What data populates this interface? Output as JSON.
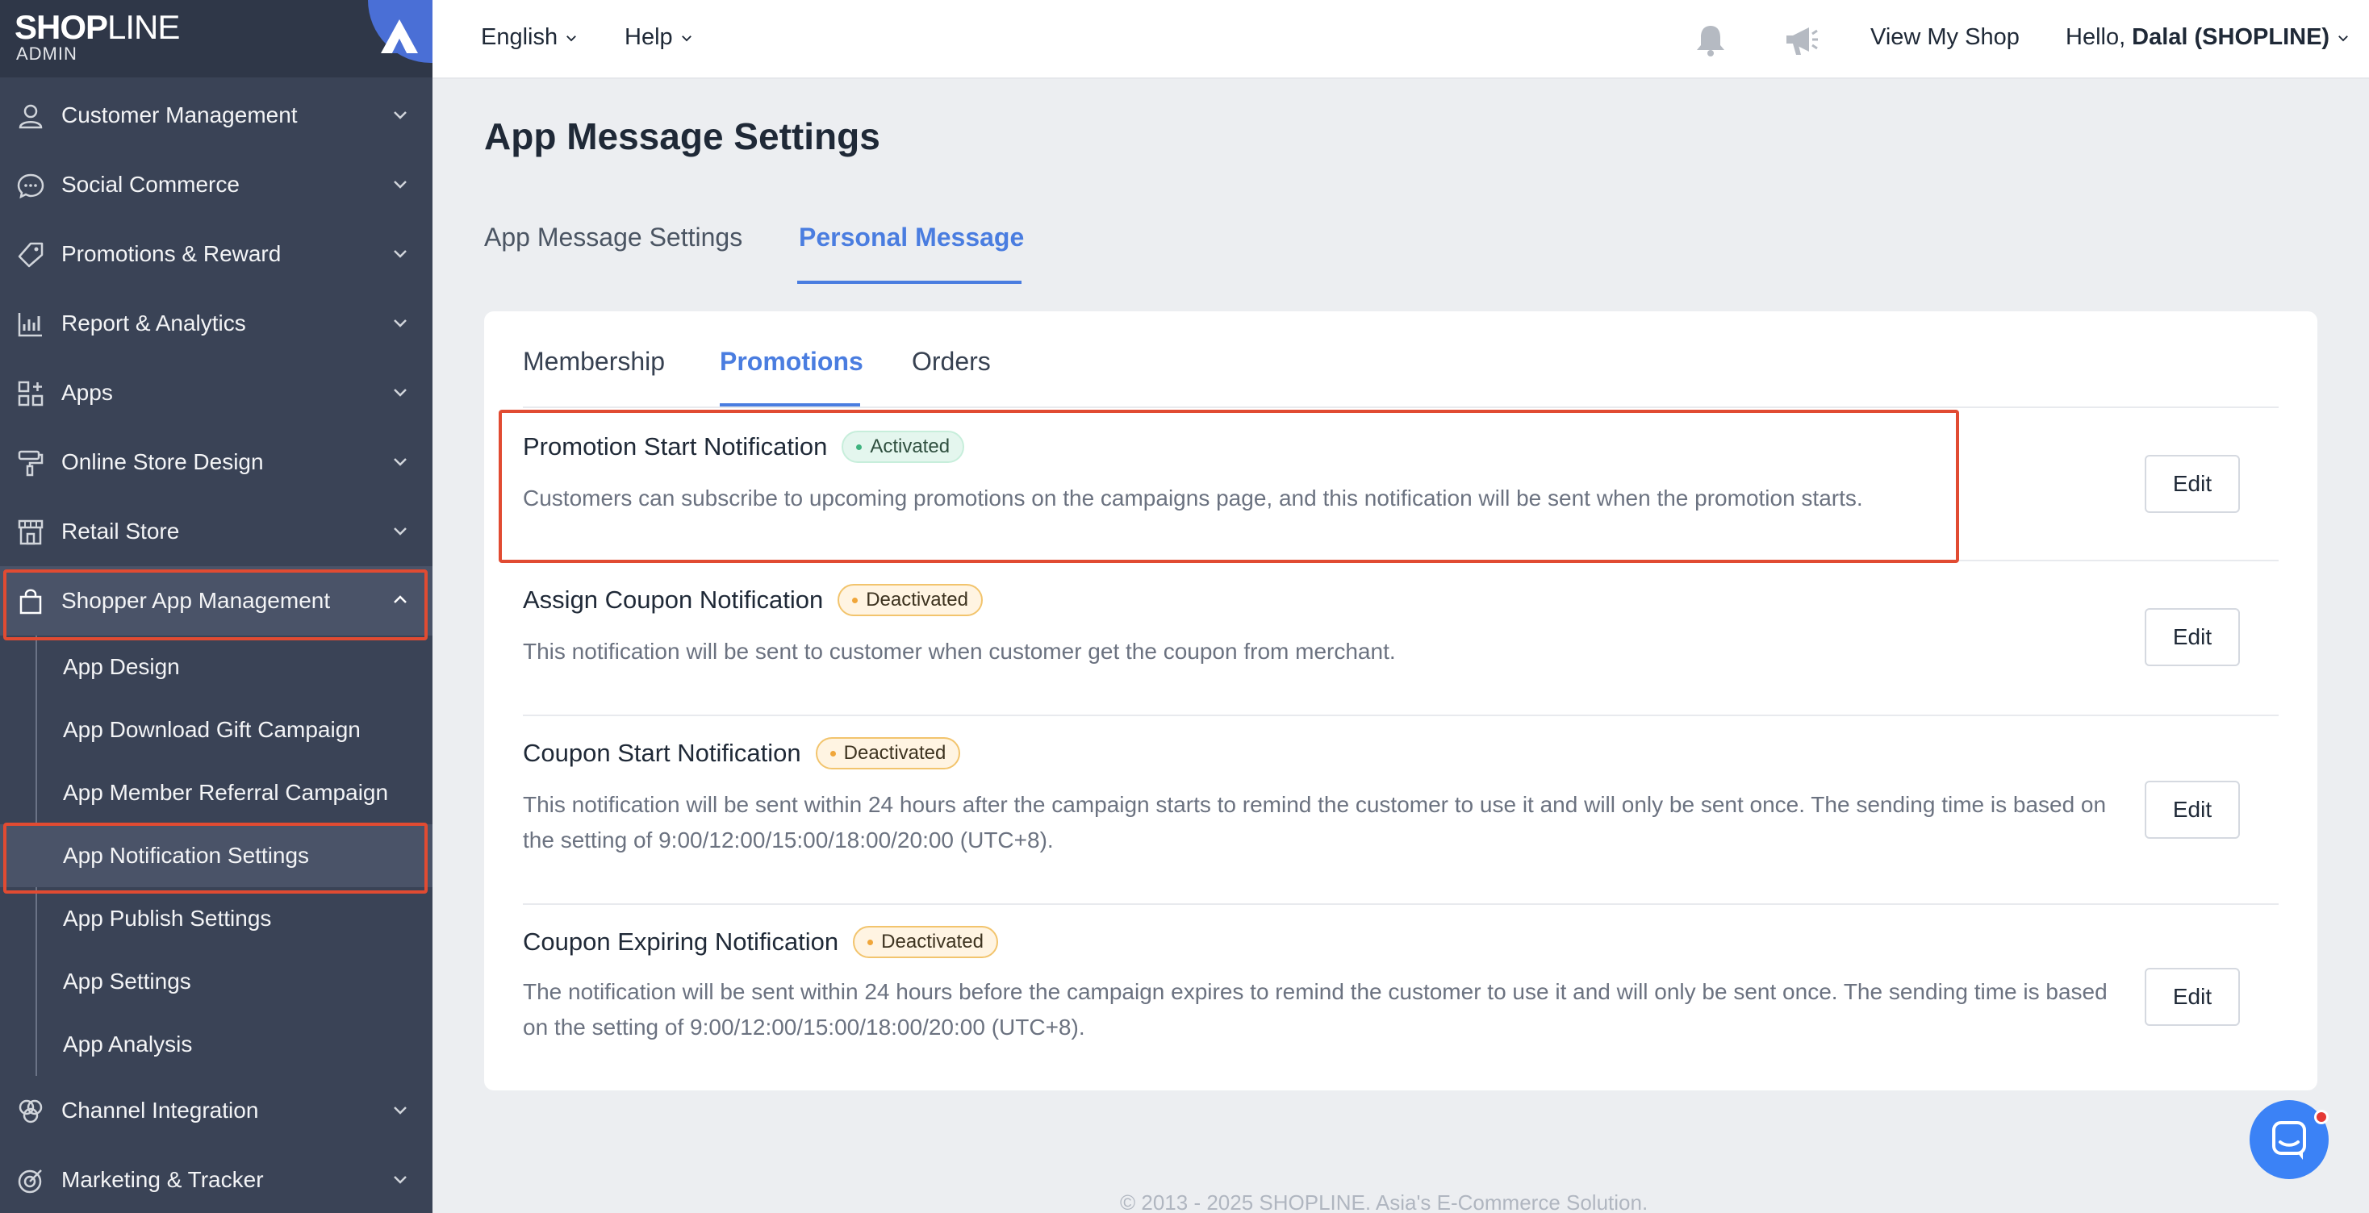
{
  "logo": {
    "brand_bold": "SHOP",
    "brand_thin": "LINE",
    "sub": "ADMIN"
  },
  "sidebar": {
    "items": [
      {
        "label": "Customer Management",
        "icon": "user-icon"
      },
      {
        "label": "Social Commerce",
        "icon": "chat-bubble-icon"
      },
      {
        "label": "Promotions & Reward",
        "icon": "tag-icon"
      },
      {
        "label": "Report & Analytics",
        "icon": "bar-chart-icon"
      },
      {
        "label": "Apps",
        "icon": "apps-grid-icon"
      },
      {
        "label": "Online Store Design",
        "icon": "paint-roller-icon"
      },
      {
        "label": "Retail Store",
        "icon": "store-icon"
      },
      {
        "label": "Shopper App Management",
        "icon": "shopping-bag-icon"
      }
    ],
    "sub_items": [
      "App Design",
      "App Download Gift Campaign",
      "App Member Referral Campaign",
      "App Notification Settings",
      "App Publish Settings",
      "App Settings",
      "App Analysis"
    ],
    "bottom_items": [
      {
        "label": "Channel Integration",
        "icon": "integration-icon"
      },
      {
        "label": "Marketing & Tracker",
        "icon": "target-icon"
      }
    ]
  },
  "topbar": {
    "language": "English",
    "help": "Help",
    "view_shop": "View My Shop",
    "hello": "Hello,",
    "user": "Dalal (SHOPLINE)"
  },
  "page": {
    "title": "App Message Settings",
    "tabs": [
      "App Message Settings",
      "Personal Message"
    ],
    "subtabs": [
      "Membership",
      "Promotions",
      "Orders"
    ]
  },
  "notifications": [
    {
      "title": "Promotion Start Notification",
      "status": "Activated",
      "desc": "Customers can subscribe to upcoming promotions on the campaigns page, and this notification will be sent when the promotion starts.",
      "edit": "Edit"
    },
    {
      "title": "Assign Coupon Notification",
      "status": "Deactivated",
      "desc": "This notification will be sent to customer when customer get the coupon from merchant.",
      "edit": "Edit"
    },
    {
      "title": "Coupon Start Notification",
      "status": "Deactivated",
      "desc": "This notification will be sent within 24 hours after the campaign starts to remind the customer to use it and will only be sent once. The sending time is based on the setting of 9:00/12:00/15:00/18:00/20:00 (UTC+8).",
      "edit": "Edit"
    },
    {
      "title": "Coupon Expiring Notification",
      "status": "Deactivated",
      "desc": "The notification will be sent within 24 hours before the campaign expires to remind the customer to use it and will only be sent once. The sending time is based on the setting of 9:00/12:00/15:00/18:00/20:00 (UTC+8).",
      "edit": "Edit"
    }
  ],
  "footer": "© 2013 - 2025 SHOPLINE. Asia's E-Commerce Solution.",
  "colors": {
    "accent": "#4a7de0",
    "highlight": "#e14b32",
    "sidebar": "#3a4356"
  }
}
